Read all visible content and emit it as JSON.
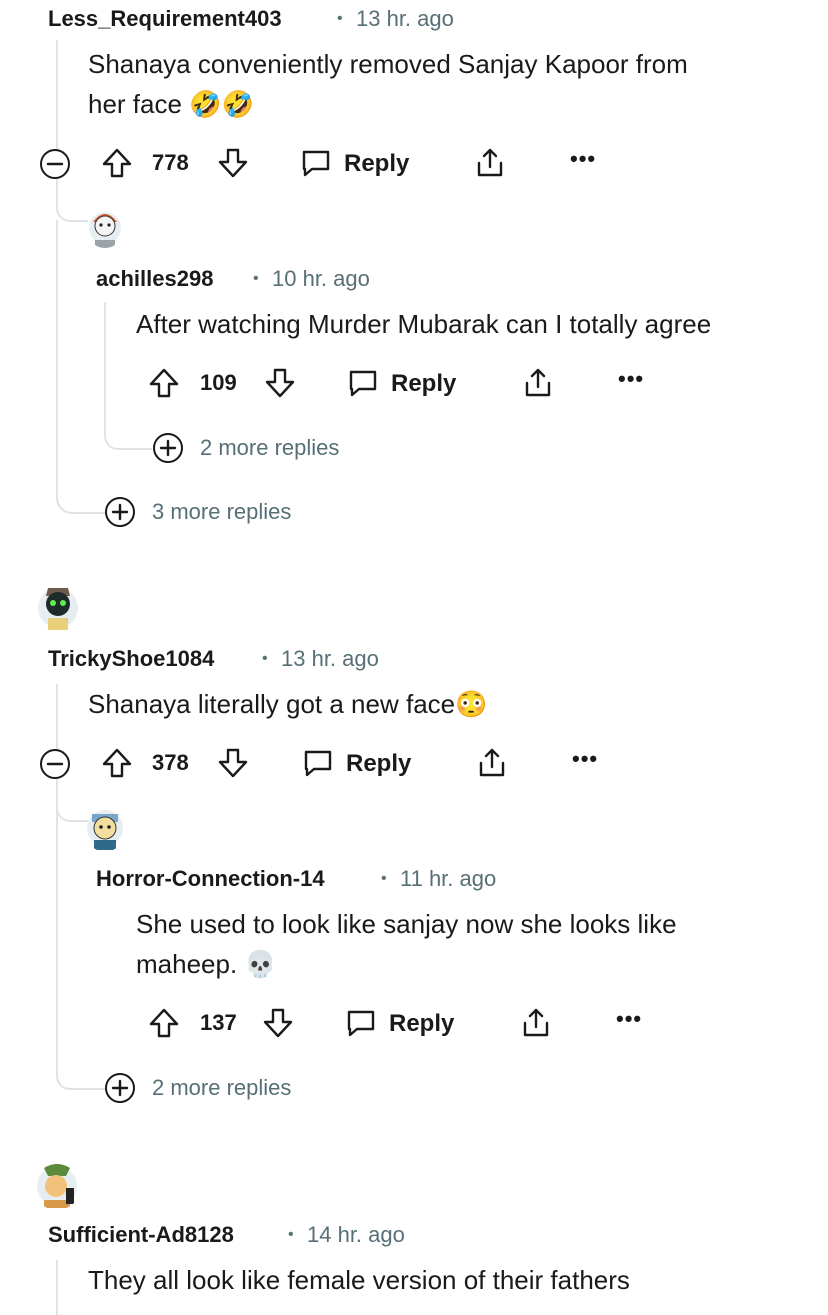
{
  "comments": [
    {
      "user": "Less_Requirement403",
      "time": "13 hr. ago",
      "body": "Shanaya conveniently removed Sanjay Kapoor from",
      "body2": "her face",
      "emoji": "🤣🤣",
      "votes": "778",
      "reply_label": "Reply",
      "replies": [
        {
          "user": "achilles298",
          "time": "10 hr. ago",
          "body": "After watching Murder Mubarak can I totally agree",
          "votes": "109",
          "reply_label": "Reply",
          "more_replies": "2 more replies"
        }
      ],
      "more_replies": "3 more replies"
    },
    {
      "user": "TrickyShoe1084",
      "time": "13 hr. ago",
      "body": "Shanaya literally got a new face",
      "emoji": "😳",
      "votes": "378",
      "reply_label": "Reply",
      "replies": [
        {
          "user": "Horror-Connection-14",
          "time": "11 hr. ago",
          "body": "She used to look like sanjay now she looks like",
          "body2": "maheep.",
          "emoji": "💀",
          "votes": "137",
          "reply_label": "Reply"
        }
      ],
      "more_replies": "2 more replies"
    },
    {
      "user": "Sufficient-Ad8128",
      "time": "14 hr. ago",
      "body": "They all look like female version of their fathers"
    }
  ],
  "separator": "•",
  "icons": {
    "upvote": "upvote-arrow-icon",
    "downvote": "downvote-arrow-icon",
    "reply": "speech-bubble-icon",
    "share": "share-icon",
    "more": "ellipsis-icon",
    "collapse": "minus-circle-icon",
    "expand": "plus-circle-icon"
  },
  "colors": {
    "text": "#1a1a1b",
    "meta": "#576f76",
    "thread_line": "#dfe3e6"
  }
}
